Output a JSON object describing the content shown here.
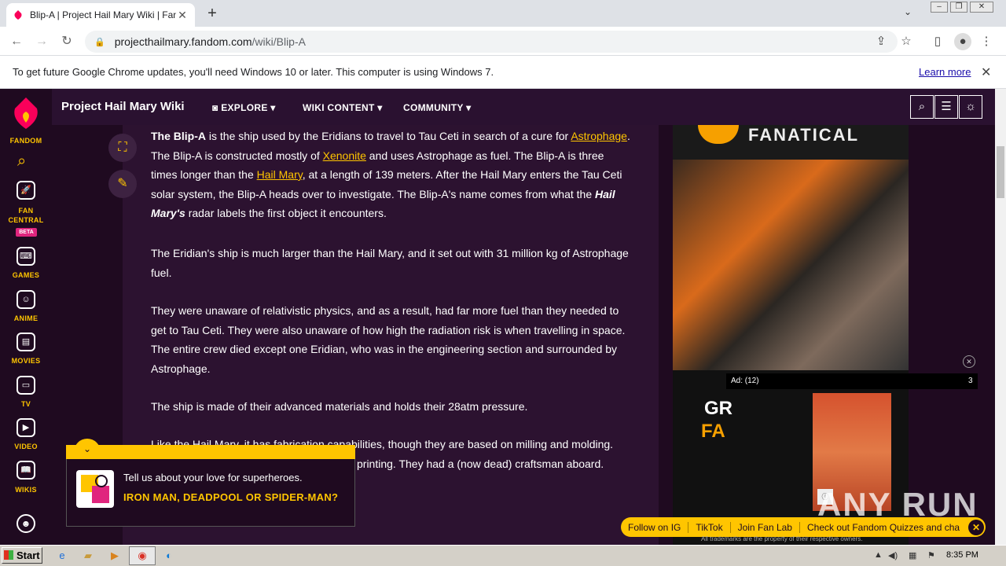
{
  "browser": {
    "tab_title": "Blip-A | Project Hail Mary Wiki | Fandom",
    "new_tab": "+",
    "url_host": "projecthailmary.fandom.com",
    "url_path": "/wiki/Blip-A"
  },
  "infobar": {
    "message": "To get future Google Chrome updates, you'll need Windows 10 or later. This computer is using Windows 7.",
    "link": "Learn more"
  },
  "global_nav": {
    "brand": "FANDOM",
    "items": [
      {
        "label": "FAN CENTRAL",
        "badge": "BETA"
      },
      {
        "label": "GAMES"
      },
      {
        "label": "ANIME"
      },
      {
        "label": "MOVIES"
      },
      {
        "label": "TV"
      },
      {
        "label": "VIDEO"
      },
      {
        "label": "WIKIS"
      }
    ]
  },
  "wiki_header": {
    "name": "Project Hail Mary Wiki",
    "nav": [
      "EXPLORE",
      "WIKI CONTENT",
      "COMMUNITY"
    ]
  },
  "article": {
    "p1": {
      "bold": "The Blip-A",
      "t1": " is the ship used by the Eridians to travel to Tau Ceti in search of a cure for ",
      "link1": "Astrophage",
      "t2": ". The Blip-A is constructed mostly of ",
      "link2": "Xenonite",
      "t3": " and uses Astrophage as fuel. The Blip-A is three times longer than the ",
      "link3": "Hail Mary",
      "t4": ", at a length of 139 meters. After the Hail Mary enters the Tau Ceti solar system, the Blip-A heads over to investigate. The Blip-A's name comes from what the ",
      "italic": "Hail Mary's",
      "t5": " radar labels the first object it encounters."
    },
    "p2": "The Eridian's ship is much larger than the Hail Mary, and it set out with 31 million kg of Astrophage fuel.",
    "p3": "They were unaware of relativistic physics, and as a result, had far more fuel than they needed to get to Tau Ceti. They were also unaware of how high the radiation risk is when travelling in space. The entire crew died except one Eridian, who was in the engineering section and surrounded by Astrophage.",
    "p4": "The ship is made of their advanced materials and holds their 28atm pressure.",
    "p5a": "Like the Hail Mary, it has fabrication capabilities, though they are based on milling and molding.",
    "p5b": "printing. They had a (now dead) craftsman aboard."
  },
  "ad": {
    "logo_text": "FANATICAL",
    "bottom_line1": "GR",
    "bottom_line2": "FA",
    "label": "Ad: (12)",
    "count": "3"
  },
  "quiz": {
    "question": "Tell us about your love for superheroes.",
    "answer": "IRON MAN, DEADPOOL OR SPIDER-MAN?"
  },
  "social_bar": {
    "items": [
      "Follow on IG",
      "TikTok",
      "Join Fan Lab",
      "Check out Fandom Quizzes and cha"
    ]
  },
  "trademark": "All trademarks are the property of their respective owners.",
  "watermark": "ANY RUN",
  "taskbar": {
    "start": "Start",
    "clock": "8:35 PM"
  }
}
